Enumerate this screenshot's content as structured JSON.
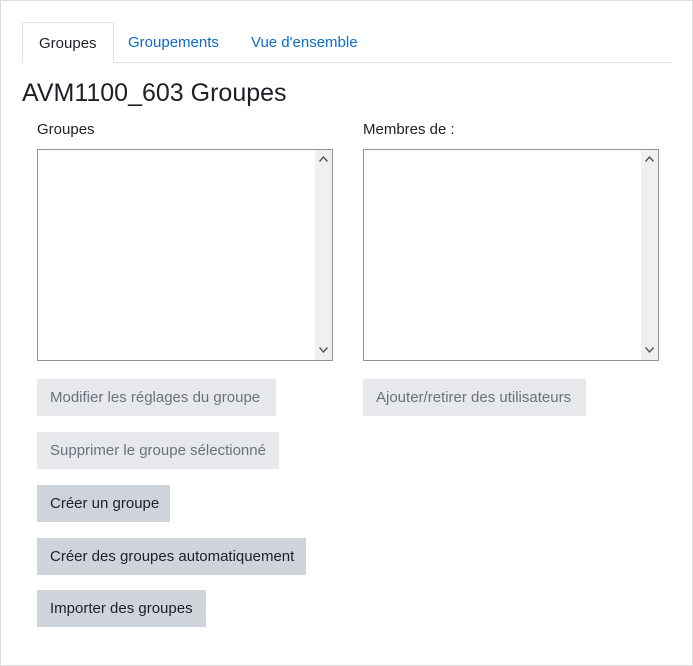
{
  "tabs": [
    {
      "label": "Groupes",
      "active": true
    },
    {
      "label": "Groupements",
      "active": false
    },
    {
      "label": "Vue d'ensemble",
      "active": false
    }
  ],
  "page": {
    "title": "AVM1100_603 Groupes"
  },
  "groups_panel": {
    "label": "Groupes",
    "items": []
  },
  "members_panel": {
    "label": "Membres de :",
    "items": []
  },
  "buttons": {
    "edit_group": "Modifier les réglages du groupe",
    "add_remove_users": "Ajouter/retirer des utilisateurs",
    "delete_group": "Supprimer le groupe sélectionné",
    "create_group": "Créer un groupe",
    "auto_create": "Créer des groupes automatiquement",
    "import_groups": "Importer des groupes"
  },
  "colors": {
    "link": "#0f6cbf",
    "button_enabled": "#ced4da",
    "button_disabled": "#e6e8eb"
  }
}
